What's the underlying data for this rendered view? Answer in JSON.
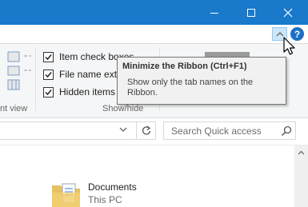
{
  "window": {
    "minimize_icon": "minimize-icon",
    "maximize_icon": "maximize-icon",
    "close_icon": "close-icon",
    "titlebar_color": "#1979ca"
  },
  "ribbon": {
    "minimize_ribbon_icon": "chevron-up-icon",
    "help_label": "?",
    "groups": {
      "current_view_label": "nt view",
      "show_hide_label": "Show/hide"
    },
    "checkboxes": [
      {
        "label": "Item check boxes",
        "checked": true
      },
      {
        "label": "File name exte",
        "checked": true
      },
      {
        "label": "Hidden items",
        "checked": true
      }
    ]
  },
  "tooltip": {
    "title": "Minimize the Ribbon (Ctrl+F1)",
    "description": "Show only the tab names on the Ribbon."
  },
  "address_bar": {
    "refresh_icon": "refresh-icon",
    "dropdown_icon": "chevron-down-icon"
  },
  "search": {
    "placeholder": "Search Quick access",
    "icon": "search-icon"
  },
  "content": {
    "items": [
      {
        "name": "Documents",
        "location": "This PC",
        "icon": "documents-folder-icon"
      }
    ]
  },
  "colors": {
    "accent": "#1979ca",
    "help": "#1e6fc8",
    "hover": "#cde6f7"
  }
}
